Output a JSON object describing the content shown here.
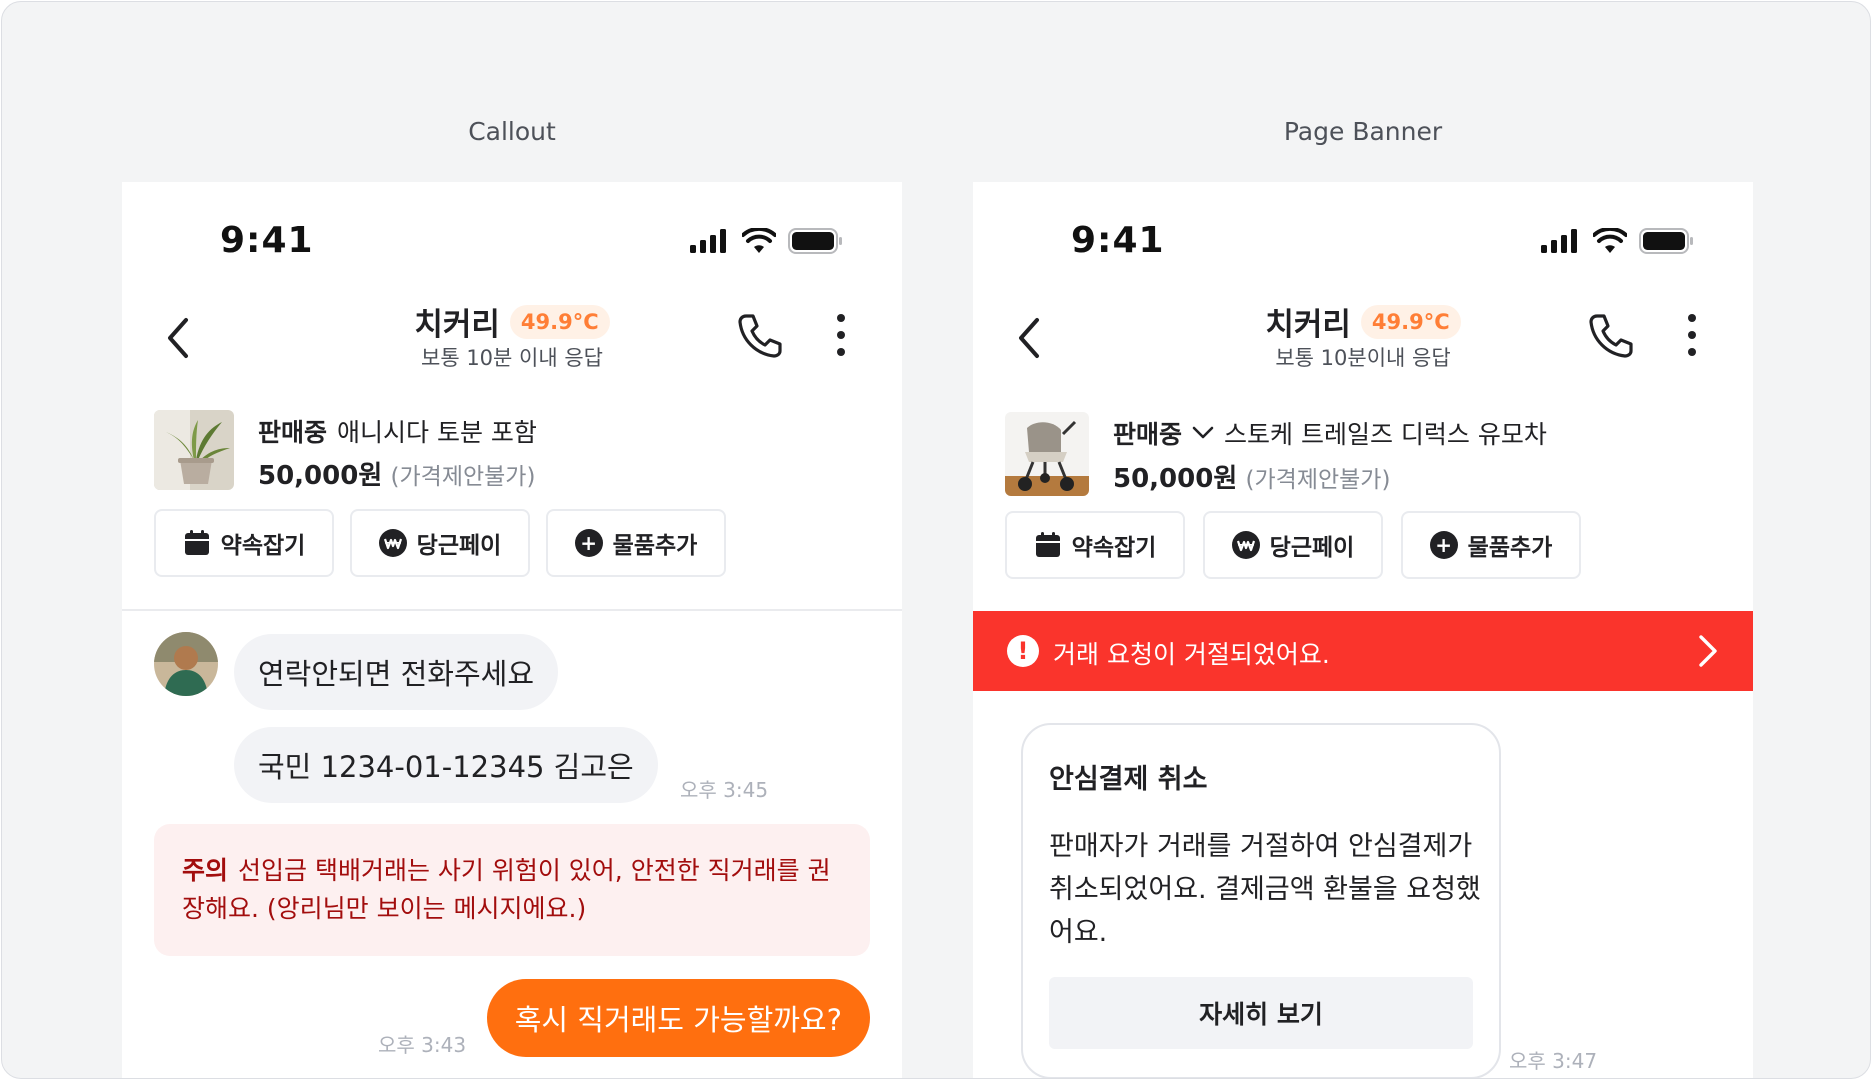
{
  "panels": [
    {
      "label": "Callout",
      "status_bar": {
        "time": "9:41"
      },
      "header": {
        "name": "치커리",
        "temperature": "49.9°C",
        "response": "보통 10분 이내 응답"
      },
      "product": {
        "status": "판매중",
        "title": "애니시다 토분 포함",
        "price": "50,000원",
        "price_note": "(가격제안불가)"
      },
      "actions": [
        "약속잡기",
        "당근페이",
        "물품추가"
      ],
      "messages": [
        {
          "text": "연락안되면 전화주세요"
        },
        {
          "text": "국민 1234-01-12345 김고은",
          "time": "오후 3:45"
        }
      ],
      "callout": {
        "label": "주의",
        "text": "선입금 택배거래는 사기 위험이 있어, 안전한 직거래를 권장해요. (앙리님만 보이는 메시지에요.)"
      },
      "outgoing": {
        "text": "혹시 직거래도 가능할까요?",
        "time": "오후 3:43"
      }
    },
    {
      "label": "Page Banner",
      "status_bar": {
        "time": "9:41"
      },
      "header": {
        "name": "치커리",
        "temperature": "49.9°C",
        "response": "보통 10분이내 응답"
      },
      "product": {
        "status": "판매중",
        "title": "스토케 트레일즈 디럭스 유모차",
        "price": "50,000원",
        "price_note": "(가격제안불가)"
      },
      "actions": [
        "약속잡기",
        "당근페이",
        "물품추가"
      ],
      "banner": {
        "text": "거래 요청이 거절되었어요."
      },
      "card": {
        "title": "안심결제 취소",
        "body": "판매자가 거래를 거절하여 안심결제가 취소되었어요. 결제금액 환불을 요청했어요.",
        "button": "자세히 보기",
        "time": "오후 3:47"
      }
    }
  ],
  "colors": {
    "brand_orange": "#ff6f0f",
    "danger": "#fa342c",
    "temp_text": "#ff7e36",
    "callout_bg": "#fdf0f0"
  }
}
